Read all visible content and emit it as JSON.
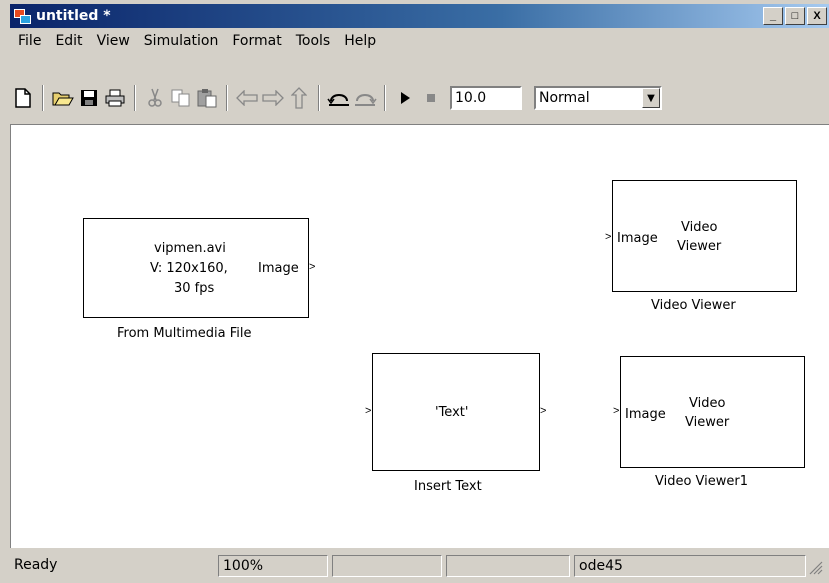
{
  "window": {
    "title": "untitled *",
    "minimize_label": "_",
    "maximize_label": "□",
    "close_label": "X"
  },
  "menu": [
    "File",
    "Edit",
    "View",
    "Simulation",
    "Format",
    "Tools",
    "Help"
  ],
  "toolbar": {
    "icons": {
      "new": "new-icon",
      "open": "open-icon",
      "save": "save-icon",
      "print": "print-icon",
      "cut": "cut-icon",
      "copy": "copy-icon",
      "paste": "paste-icon",
      "back": "back-arrow-icon",
      "forward": "forward-arrow-icon",
      "up": "up-arrow-icon",
      "undo": "undo-icon",
      "redo": "redo-icon",
      "start": "start-icon",
      "stop": "stop-icon"
    },
    "stop_time": "10.0",
    "sim_mode": "Normal"
  },
  "blocks": {
    "from_file": {
      "line1": "vipmen.avi",
      "line2": "V: 120x160,",
      "line3": "30 fps",
      "out_port": "Image",
      "label": "From Multimedia File"
    },
    "insert_text": {
      "content": "'Text'",
      "label": "Insert Text"
    },
    "viewer1": {
      "in_port": "Image",
      "title_line1": "Video",
      "title_line2": "Viewer",
      "label": "Video Viewer"
    },
    "viewer2": {
      "in_port": "Image",
      "title_line1": "Video",
      "title_line2": "Viewer",
      "label": "Video Viewer1"
    }
  },
  "status": {
    "state": "Ready",
    "zoom": "100%",
    "empty1": "",
    "empty2": "",
    "solver": "ode45"
  },
  "colors": {
    "title_start": "#0a246a",
    "title_end": "#a6caf0",
    "chrome": "#d4d0c8",
    "canvas": "#ffffff"
  }
}
